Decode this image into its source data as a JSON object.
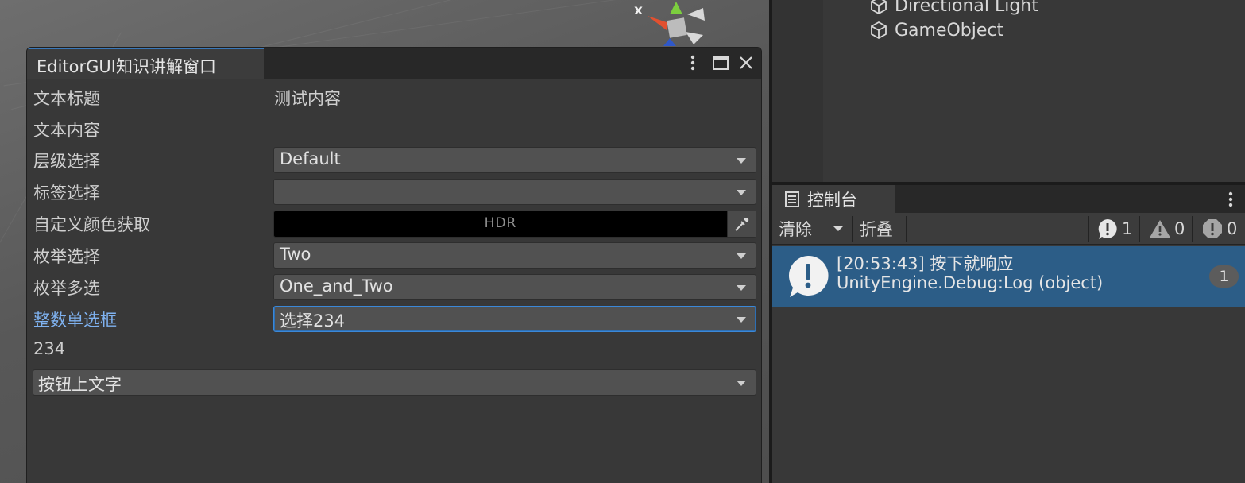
{
  "editor_window": {
    "title": "EditorGUI知识讲解窗口",
    "rows": {
      "text_title_label": "文本标题",
      "text_title_value": "测试内容",
      "text_content_label": "文本内容",
      "layer_label": "层级选择",
      "layer_value": "Default",
      "tag_label": "标签选择",
      "tag_value": "",
      "color_label": "自定义颜色获取",
      "color_hdr_text": "HDR",
      "color_value": "#000000",
      "enum_label": "枚举选择",
      "enum_value": "Two",
      "enum_multi_label": "枚举多选",
      "enum_multi_value": "One_and_Two",
      "int_popup_label": "整数单选框",
      "int_popup_value": "选择234",
      "int_result": "234",
      "dropdown_button_label": "按钮上文字"
    }
  },
  "scene": {
    "gizmo_axis_label": "x"
  },
  "hierarchy": {
    "items": [
      "Directional Light",
      "GameObject"
    ]
  },
  "console": {
    "tab_label": "控制台",
    "clear_label": "清除",
    "collapse_label": "折叠",
    "info_count": "1",
    "warning_count": "0",
    "error_count": "0",
    "log": {
      "line1": "[20:53:43] 按下就响应",
      "line2": "UnityEngine.Debug:Log (object)",
      "count": "1"
    }
  },
  "colors": {
    "accent": "#3a79bb",
    "selected_log_bg": "#2c5d87",
    "focused_label": "#7fb2f0"
  }
}
